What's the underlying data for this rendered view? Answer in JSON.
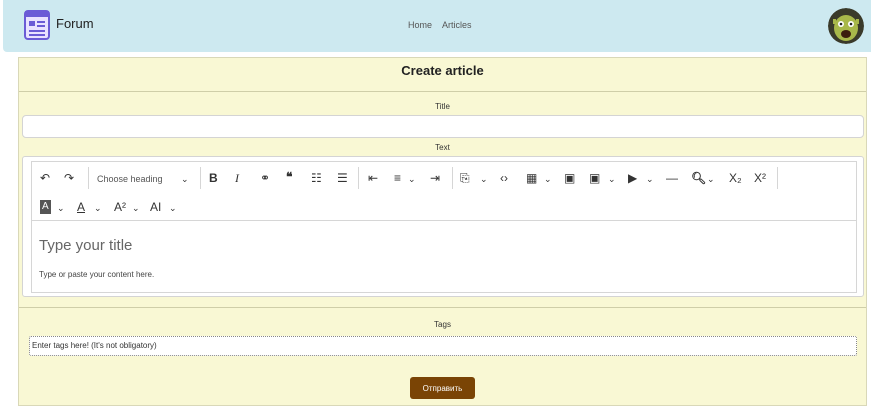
{
  "navbar": {
    "brand": "Forum",
    "links": [
      "Home",
      "Articles"
    ],
    "brand_icon": "browser-window-icon",
    "avatar": "user-avatar"
  },
  "form": {
    "heading": "Create article",
    "title_label": "Title",
    "title_value": "",
    "text_label": "Text",
    "editor": {
      "heading_select": "Choose heading",
      "placeholder_title": "Type your title",
      "placeholder_body": "Type or paste your content here.",
      "tools": [
        "undo-icon",
        "redo-icon",
        "bold-icon",
        "italic-icon",
        "link-icon",
        "blockquote-icon",
        "bulleted-list-icon",
        "numbered-list-icon",
        "outdent-icon",
        "align-icon",
        "indent-icon",
        "source-icon",
        "code-icon",
        "table-icon",
        "image-icon",
        "insert-image-icon",
        "media-icon",
        "horizontal-line-icon",
        "find-replace-icon",
        "subscript-icon",
        "superscript-icon",
        "font-background-icon",
        "font-color-icon",
        "font-size-icon",
        "font-family-icon"
      ]
    },
    "tags_label": "Tags",
    "tags_placeholder": "Enter tags here! (It's not obligatory)",
    "submit_label": "Отправить"
  },
  "colors": {
    "navbar_bg": "#cde9f0",
    "card_bg": "#f9f8d4",
    "submit_bg": "#7a4405"
  }
}
